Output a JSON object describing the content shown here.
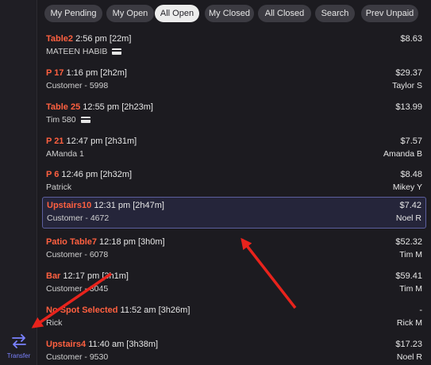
{
  "tabs": [
    {
      "label": "My Pending",
      "active": false
    },
    {
      "label": "My Open",
      "active": false
    },
    {
      "label": "All Open",
      "active": true
    },
    {
      "label": "My Closed",
      "active": false
    },
    {
      "label": "All Closed",
      "active": false
    },
    {
      "label": "Search",
      "active": false
    },
    {
      "label": "Prev Unpaid",
      "active": false
    }
  ],
  "checks": [
    {
      "location": "Table2",
      "time": " 2:56 pm [22m]",
      "customer": "MATEEN HABIB",
      "card": true,
      "amount": "$8.63",
      "server": ""
    },
    {
      "location": "P 17",
      "time": " 1:16 pm [2h2m]",
      "customer": "Customer - 5998",
      "card": false,
      "amount": "$29.37",
      "server": "Taylor S"
    },
    {
      "location": "Table 25",
      "time": " 12:55 pm [2h23m]",
      "customer": "Tim 580",
      "card": true,
      "amount": "$13.99",
      "server": ""
    },
    {
      "location": "P 21",
      "time": " 12:47 pm [2h31m]",
      "customer": "AManda 1",
      "card": false,
      "amount": "$7.57",
      "server": "Amanda B"
    },
    {
      "location": "P 6",
      "time": " 12:46 pm [2h32m]",
      "customer": "Patrick",
      "card": false,
      "amount": "$8.48",
      "server": "Mikey Y"
    },
    {
      "location": "Upstairs10",
      "time": " 12:31 pm [2h47m]",
      "customer": "Customer - 4672",
      "card": false,
      "amount": "$7.42",
      "server": "Noel R",
      "selected": true
    },
    {
      "location": "Patio Table7",
      "time": " 12:18 pm [3h0m]",
      "customer": "Customer - 6078",
      "card": false,
      "amount": "$52.32",
      "server": "Tim M"
    },
    {
      "location": "Bar",
      "time": " 12:17 pm [3h1m]",
      "customer": "Customer - 3045",
      "card": false,
      "amount": "$59.41",
      "server": "Tim M"
    },
    {
      "location": "No Spot Selected",
      "time": " 11:52 am [3h26m]",
      "customer": "Rick",
      "card": false,
      "amount": "-",
      "server": "Rick M"
    },
    {
      "location": "Upstairs4",
      "time": " 11:40 am [3h38m]",
      "customer": "Customer - 9530",
      "card": false,
      "amount": "$17.23",
      "server": "Noel R"
    }
  ],
  "sidebar": {
    "transfer_label": "Transfer",
    "transfer_icon": "transfer-arrows-icon"
  },
  "colors": {
    "accent": "#7b82ff",
    "location": "#ff6040",
    "annotation_arrow": "#e8231c"
  }
}
